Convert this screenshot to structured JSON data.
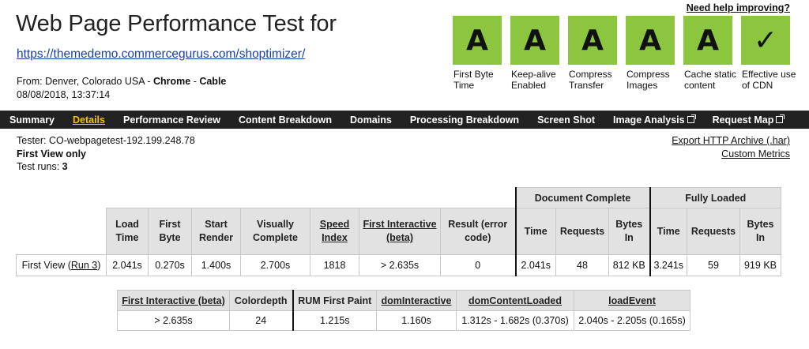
{
  "header": {
    "title": "Web Page Performance Test for",
    "url": "https://themedemo.commercegurus.com/shoptimizer/",
    "from_prefix": "From: Denver, Colorado USA - ",
    "browser": "Chrome",
    "sep": " - ",
    "connection": "Cable",
    "date": "08/08/2018, 13:37:14",
    "help_link": "Need help improving?"
  },
  "grades": [
    {
      "grade": "A",
      "label": "First Byte Time"
    },
    {
      "grade": "A",
      "label": "Keep-alive Enabled"
    },
    {
      "grade": "A",
      "label": "Compress Transfer"
    },
    {
      "grade": "A",
      "label": "Compress Images"
    },
    {
      "grade": "A",
      "label": "Cache static content"
    },
    {
      "grade": "✓",
      "label": "Effective use of CDN"
    }
  ],
  "nav": {
    "items": [
      "Summary",
      "Details",
      "Performance Review",
      "Content Breakdown",
      "Domains",
      "Processing Breakdown",
      "Screen Shot",
      "Image Analysis",
      "Request Map"
    ],
    "active": "Details"
  },
  "info": {
    "tester": "Tester: CO-webpagetest-192.199.248.78",
    "view": "First View only",
    "runs_label": "Test runs: ",
    "runs_value": "3",
    "export_link": "Export HTTP Archive (.har)",
    "metrics_link": "Custom Metrics"
  },
  "summary_table": {
    "group_doc": "Document Complete",
    "group_full": "Fully Loaded",
    "headers": {
      "load_time": "Load Time",
      "first_byte": "First Byte",
      "start_render": "Start Render",
      "visually_complete": "Visually Complete",
      "speed_index": "Speed Index",
      "first_interactive": "First Interactive (beta)",
      "result": "Result (error code)",
      "doc_time": "Time",
      "doc_requests": "Requests",
      "doc_bytes": "Bytes In",
      "full_time": "Time",
      "full_requests": "Requests",
      "full_bytes": "Bytes In"
    },
    "row": {
      "label": "First View (",
      "run_link": "Run 3",
      "label_end": ")",
      "load_time": "2.041s",
      "first_byte": "0.270s",
      "start_render": "1.400s",
      "visually_complete": "2.700s",
      "speed_index": "1818",
      "first_interactive": "> 2.635s",
      "result": "0",
      "doc_time": "2.041s",
      "doc_requests": "48",
      "doc_bytes": "812 KB",
      "full_time": "3.241s",
      "full_requests": "59",
      "full_bytes": "919 KB"
    }
  },
  "detail_table": {
    "headers": [
      "First Interactive (beta)",
      "Colordepth",
      "RUM First Paint",
      "domInteractive",
      "domContentLoaded",
      "loadEvent"
    ],
    "values": [
      "> 2.635s",
      "24",
      "1.215s",
      "1.160s",
      "1.312s - 1.682s (0.370s)",
      "2.040s - 2.205s (0.165s)"
    ]
  }
}
